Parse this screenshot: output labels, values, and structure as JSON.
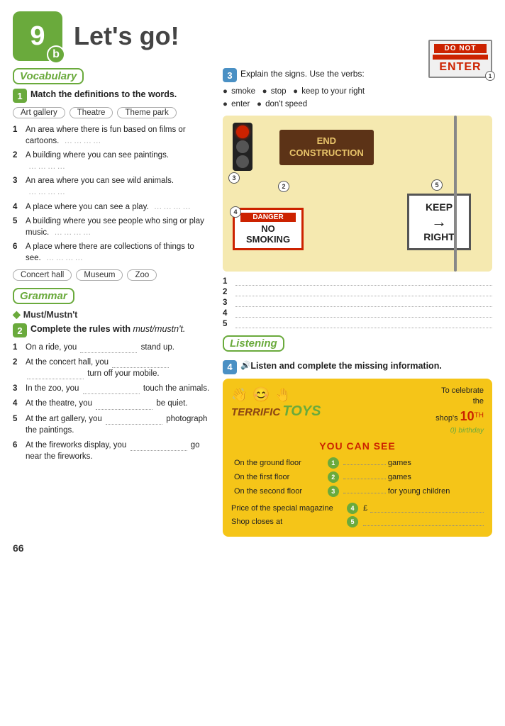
{
  "header": {
    "number": "9",
    "letter": "b",
    "title": "Let's go!"
  },
  "vocabulary": {
    "section_label": "Vocabulary",
    "exercise1": {
      "badge": "1",
      "title": "Match the definitions to the words.",
      "tags": [
        "Art gallery",
        "Theatre",
        "Theme park"
      ],
      "definitions": [
        {
          "num": "1",
          "text": "An area where there is fun based on films or cartoons.",
          "dots": "…………"
        },
        {
          "num": "2",
          "text": "A building where you can see paintings.",
          "dots": "…………"
        },
        {
          "num": "3",
          "text": "An area where you can see wild animals.",
          "dots": "…………"
        },
        {
          "num": "4",
          "text": "A place where you can see a play.",
          "dots": "…………"
        },
        {
          "num": "5",
          "text": "A building where you see people who sing or play music.",
          "dots": "…………"
        },
        {
          "num": "6",
          "text": "A place where there are collections of things to see.",
          "dots": "…………"
        }
      ],
      "tags2": [
        "Concert hall",
        "Museum",
        "Zoo"
      ]
    }
  },
  "grammar": {
    "section_label": "Grammar",
    "rule": "Must/Mustn't",
    "exercise2": {
      "badge": "2",
      "title": "Complete the rules with",
      "italic": "must/mustn't.",
      "items": [
        {
          "num": "1",
          "text": "On a ride, you ………………… stand up."
        },
        {
          "num": "2",
          "text": "At the concert hall, you ………… ………… turn off your mobile."
        },
        {
          "num": "3",
          "text": "In the zoo, you ………………… touch the animals."
        },
        {
          "num": "4",
          "text": "At the theatre, you ………… be quiet."
        },
        {
          "num": "5",
          "text": "At the art gallery, you ………… photograph the paintings."
        },
        {
          "num": "6",
          "text": "At the fireworks display, you ………………… go near the fireworks."
        }
      ]
    }
  },
  "signs": {
    "exercise3": {
      "badge": "3",
      "instruction": "Explain the signs. Use the verbs:",
      "verbs": [
        "smoke",
        "stop",
        "keep to your right",
        "enter",
        "don't speed"
      ],
      "sign_labels": {
        "do_not_enter": "DO NOT\nENTER",
        "end_construction": "END\nCONSTRUCTION",
        "danger": "DANGER",
        "no_smoking": "NO\nSMOKING",
        "keep": "KEEP",
        "right": "RIGHT"
      },
      "answer_nums": [
        "1",
        "2",
        "3",
        "4",
        "5"
      ]
    }
  },
  "listening": {
    "section_label": "Listening",
    "exercise4": {
      "badge": "4",
      "instruction": "Listen and complete the missing information.",
      "toys_box": {
        "logo_terrific": "TERRIFIC",
        "logo_toys": "TOYS",
        "celebrate_line1": "To celebrate",
        "celebrate_line2": "the",
        "celebrate_line3": "shop's",
        "birthday_num": "10",
        "birthday_th": "TH",
        "birthday_label": "0) birthday",
        "you_can_see": "YOU CAN SEE",
        "floors": [
          {
            "label": "On the ground floor",
            "num": "1",
            "suffix": "games"
          },
          {
            "label": "On the first floor",
            "num": "2",
            "suffix": "games"
          },
          {
            "label": "On the second floor",
            "num": "3",
            "suffix": "for young children"
          }
        ],
        "price_label": "Price of the special magazine",
        "price_num": "4",
        "price_prefix": "£",
        "shop_label": "Shop closes at",
        "shop_num": "5"
      }
    }
  },
  "page_number": "66"
}
